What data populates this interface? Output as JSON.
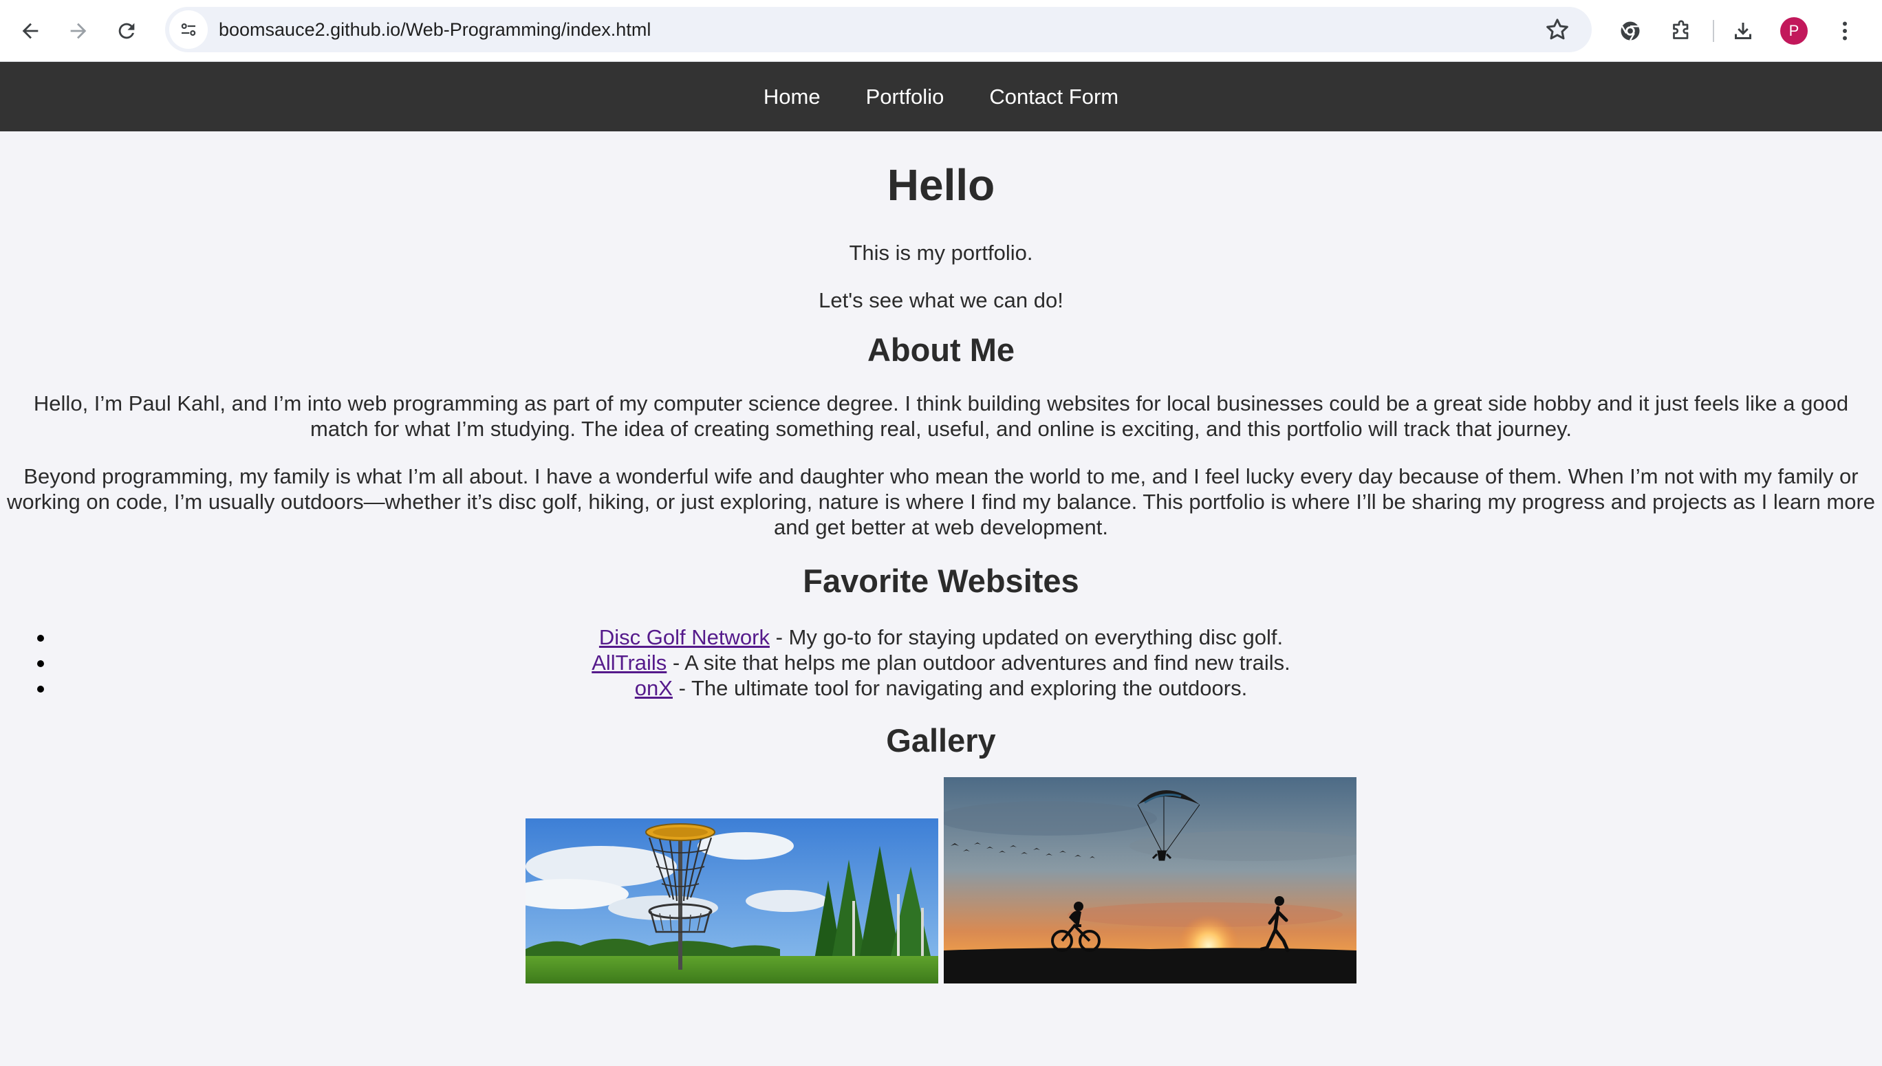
{
  "browser": {
    "url": "boomsauce2.github.io/Web-Programming/index.html",
    "avatar_letter": "P",
    "icons": [
      "back-icon",
      "forward-icon",
      "reload-icon",
      "site-info-icon",
      "bookmark-star-icon",
      "chrome-labs-icon",
      "extensions-icon",
      "download-icon",
      "profile-avatar",
      "menu-kebab-icon"
    ]
  },
  "nav": {
    "links": [
      "Home",
      "Portfolio",
      "Contact Form"
    ]
  },
  "hero": {
    "title": "Hello",
    "line1": "This is my portfolio.",
    "line2": "Let's see what we can do!"
  },
  "about": {
    "heading": "About Me",
    "paragraph1": "Hello, I’m Paul Kahl, and I’m into web programming as part of my computer science degree. I think building websites for local businesses could be a great side hobby and it just feels like a good match for what I’m studying. The idea of creating something real, useful, and online is exciting, and this portfolio will track that journey.",
    "paragraph2": "Beyond programming, my family is what I’m all about. I have a wonderful wife and daughter who mean the world to me, and I feel lucky every day because of them. When I’m not with my family or working on code, I’m usually outdoors—whether it’s disc golf, hiking, or just exploring, nature is where I find my balance. This portfolio is where I’ll be sharing my progress and projects as I learn more and get better at web development."
  },
  "favorites": {
    "heading": "Favorite Websites",
    "items": [
      {
        "link": "Disc Golf Network",
        "desc": " - My go-to for staying updated on everything disc golf."
      },
      {
        "link": "AllTrails",
        "desc": " - A site that helps me plan outdoor adventures and find new trails."
      },
      {
        "link": "onX",
        "desc": " - The ultimate tool for navigating and exploring the outdoors."
      }
    ]
  },
  "gallery": {
    "heading": "Gallery",
    "images": [
      "disc-golf-basket-photo",
      "sunset-paraglider-photo"
    ]
  },
  "colors": {
    "nav_bg": "#333333",
    "page_bg": "#f4f4f8",
    "link_visited": "#551a8b",
    "text": "#2b2b2b"
  }
}
